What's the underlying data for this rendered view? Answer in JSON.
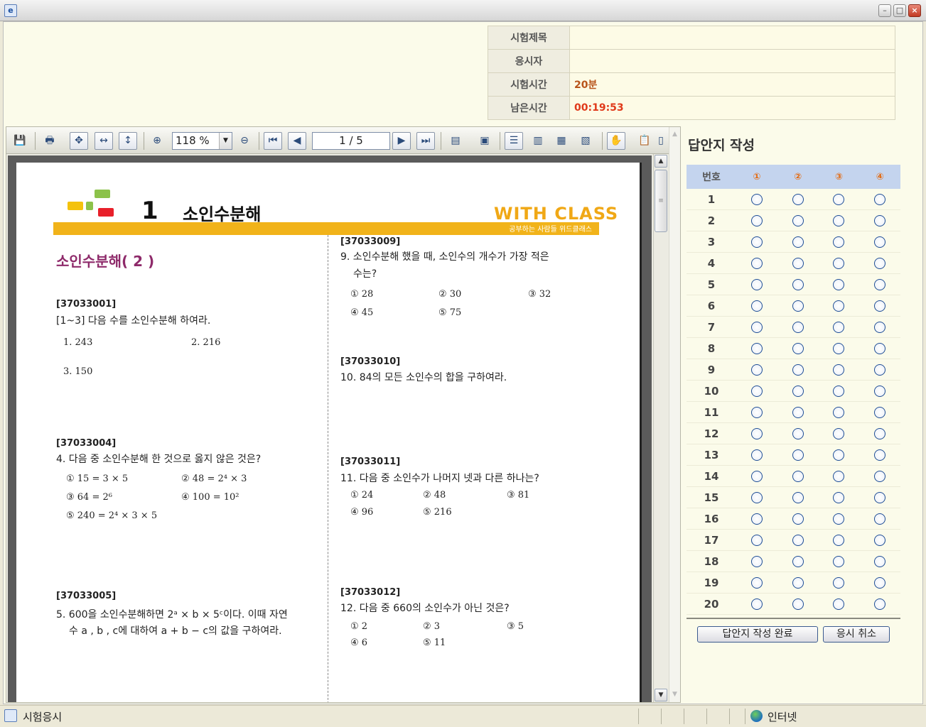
{
  "window": {
    "minimize": "–",
    "maximize": "□",
    "close": "×"
  },
  "exam_info": [
    {
      "label": "시험제목",
      "value": ""
    },
    {
      "label": "응시자",
      "value": ""
    },
    {
      "label": "시험시간",
      "value": "20분"
    },
    {
      "label": "남은시간",
      "value": "00:19:53"
    }
  ],
  "toolbar": {
    "zoom": "118 %",
    "page": "1 / 5"
  },
  "document": {
    "chapter_number": "1",
    "chapter_title": "소인수분해",
    "brand": "WITH CLASS",
    "brand_sub": "공부하는 사람들 위드클래스",
    "section_title": "소인수분해( 2 )",
    "questions": [
      {
        "id": "[37033001]",
        "text": "[1~3] 다음 수를 소인수분해 하여라.",
        "options": [
          "1.  243",
          "2.  216",
          "3.  150"
        ]
      },
      {
        "id": "[37033004]",
        "text": "4. 다음 중 소인수분해 한 것으로 옳지 않은 것은?",
        "options": [
          "① 15 = 3 × 5",
          "② 48 = 2⁴ × 3",
          "③ 64 = 2⁶",
          "④ 100 = 10²",
          "⑤ 240 = 2⁴ × 3 × 5"
        ]
      },
      {
        "id": "[37033005]",
        "text": "5. 600을 소인수분해하면 2ᵃ × b × 5ᶜ이다. 이때 자연",
        "text2": "수 a , b , c에 대하여 a + b − c의 값을 구하여라.",
        "options": []
      },
      {
        "id": "[37033009]",
        "text": "9. 소인수분해 했을 때, 소인수의 개수가 가장 적은",
        "text2": "수는?",
        "options": [
          "① 28",
          "② 30",
          "③ 32",
          "④ 45",
          "⑤ 75"
        ]
      },
      {
        "id": "[37033010]",
        "text": "10. 84의 모든 소인수의 합을 구하여라.",
        "options": []
      },
      {
        "id": "[37033011]",
        "text": "11. 다음 중 소인수가 나머지 넷과 다른 하나는?",
        "options": [
          "① 24",
          "② 48",
          "③ 81",
          "④ 96",
          "⑤ 216"
        ]
      },
      {
        "id": "[37033012]",
        "text": "12. 다음 중 660의 소인수가 아닌 것은?",
        "options": [
          "① 2",
          "② 3",
          "③ 5",
          "④ 6",
          "⑤ 11"
        ]
      }
    ]
  },
  "answer_sheet": {
    "title": "답안지 작성",
    "header": [
      "번호",
      "①",
      "②",
      "③",
      "④"
    ],
    "rows": [
      "1",
      "2",
      "3",
      "4",
      "5",
      "6",
      "7",
      "8",
      "9",
      "10",
      "11",
      "12",
      "13",
      "14",
      "15",
      "16",
      "17",
      "18",
      "19",
      "20"
    ],
    "submit_label": "답안지 작성 완료",
    "cancel_label": "응시 취소"
  },
  "status": {
    "text": "시험응시",
    "zone": "인터넷"
  },
  "colors": {
    "brand_orange": "#f1b31a",
    "section_purple": "#8e2a6a",
    "time_red": "#e03a1a",
    "sheet_header": "#c4d4ee"
  }
}
